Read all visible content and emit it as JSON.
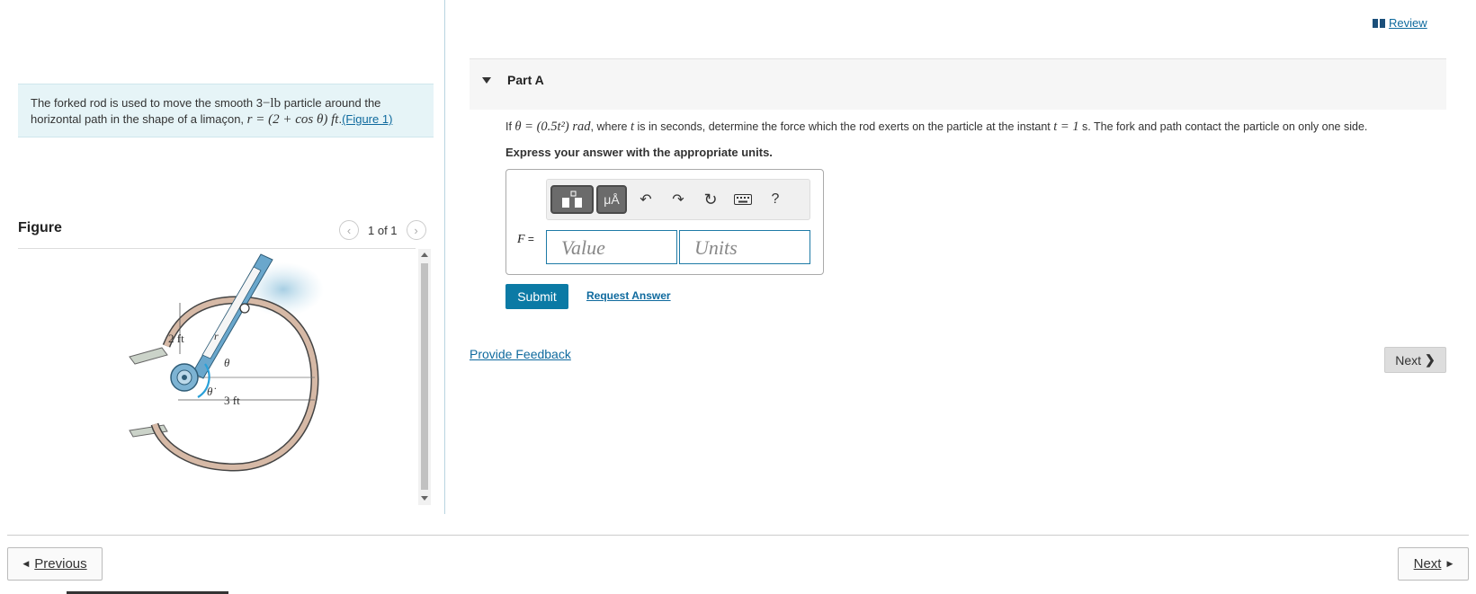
{
  "intro": {
    "text_1": "The forked rod is used to move the smooth 3",
    "mass": "−lb",
    "text_2": " particle around the horizontal path in the shape of a limaçon, ",
    "equation": "r = (2 + cos θ) ft",
    "text_3": ".",
    "figure_link": "(Figure 1)"
  },
  "figure": {
    "title": "Figure",
    "counter": "1 of 1",
    "labels": {
      "two_ft": "2 ft",
      "three_ft": "3 ft",
      "theta": "θ",
      "theta_dot": "θ̇",
      "r": "r"
    }
  },
  "header": {
    "review_label": "Review"
  },
  "part": {
    "title": "Part A",
    "q_1": "If ",
    "q_theta": "θ = (0.5t²) rad",
    "q_2": ", where ",
    "q_t": "t",
    "q_3": " is in seconds, determine the force which the rod exerts on the particle at the instant ",
    "q_t1": "t = 1",
    "q_4": " s. The fork and path contact the particle on only one side.",
    "instruction": "Express your answer with the appropriate units."
  },
  "answer": {
    "var": "F",
    "eq": " =",
    "value_placeholder": "Value",
    "units_placeholder": "Units",
    "toolbar": {
      "units_btn": "μÅ",
      "help": "?"
    }
  },
  "actions": {
    "submit": "Submit",
    "request_answer": "Request Answer",
    "provide_feedback": "Provide Feedback",
    "next": "Next"
  },
  "footer": {
    "previous": "Previous",
    "next": "Next"
  }
}
